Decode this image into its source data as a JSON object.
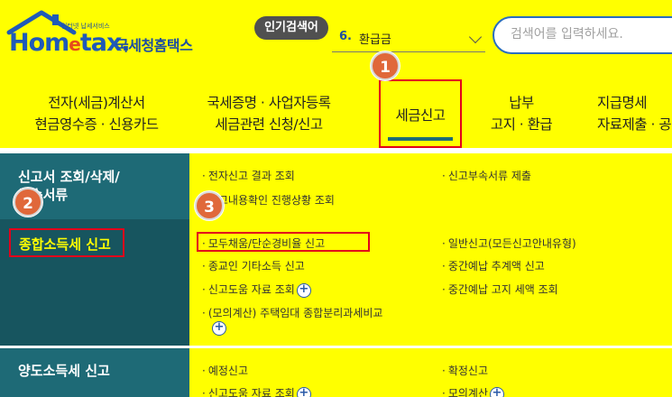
{
  "logo": {
    "tagline": "인터넷 납세서비스",
    "word_main": "Hom",
    "word_accent": "e",
    "word_tail": "tax.",
    "korean_name": "국세청홈택스",
    "colors": {
      "blue": "#1f5ab8",
      "orange": "#e64b1b"
    }
  },
  "popular_search": {
    "badge": "인기검색어",
    "rank": "6.",
    "term": "환급금"
  },
  "search": {
    "placeholder": "검색어를 입력하세요."
  },
  "nav": {
    "items": [
      {
        "line1": "전자(세금)계산서",
        "line2": "현금영수증 · 신용카드"
      },
      {
        "line1": "국세증명 · 사업자등록",
        "line2": "세금관련 신청/신고"
      },
      {
        "line1": "세금신고",
        "line2": ""
      },
      {
        "line1": "납부",
        "line2": "고지 · 환급"
      },
      {
        "line1": "지급명세",
        "line2": "자료제출 · 공"
      }
    ],
    "active_index": 2
  },
  "left_menu": {
    "items": [
      {
        "line1": "신고서 조회/삭제/",
        "line2": "부속서류"
      },
      {
        "line1": "종합소득세 신고",
        "line2": ""
      },
      {
        "line1": "양도소득세 신고",
        "line2": ""
      }
    ]
  },
  "content": {
    "row1_left": [
      "전자신고 결과 조회",
      "신고내용확인 진행상황 조회"
    ],
    "row1_right": [
      "신고부속서류 제출"
    ],
    "row2_left": [
      "모두채움/단순경비율 신고",
      "종교인 기타소득 신고",
      "신고도움 자료 조회",
      "(모의계산) 주택임대 종합분리과세비교"
    ],
    "row2_right": [
      "일반신고(모든신고안내유형)",
      "중간예납 추계액 신고",
      "중간예납 고지 세액 조회"
    ],
    "row3_left": [
      "예정신고",
      "신고도움 자료 조회"
    ],
    "row3_right": [
      "확정신고",
      "모의계산"
    ]
  },
  "steps": [
    "1",
    "2",
    "3"
  ],
  "colors": {
    "background": "#ffff00",
    "menu_teal": "#1e6a76",
    "menu_dark": "#17555f",
    "highlight_red": "#e3001b",
    "step_orange": "#e0683a"
  }
}
